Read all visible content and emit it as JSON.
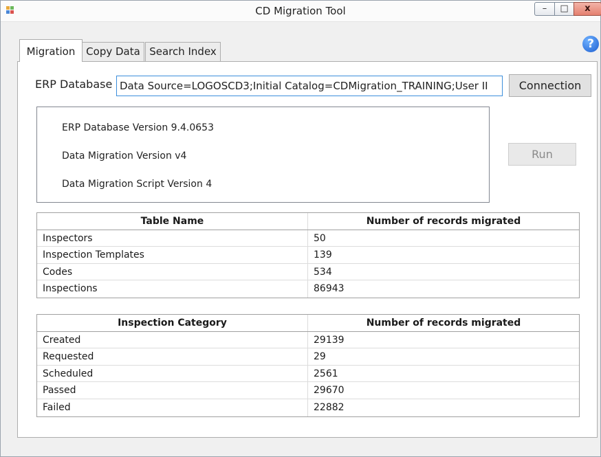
{
  "window": {
    "title": "CD Migration Tool",
    "minimize_glyph": "–",
    "maximize_glyph": "□",
    "close_glyph": "x",
    "help_glyph": "?"
  },
  "tabs": [
    {
      "label": "Migration",
      "active": true
    },
    {
      "label": "Copy Data",
      "active": false
    },
    {
      "label": "Search Index",
      "active": false
    }
  ],
  "erp": {
    "label": "ERP Database",
    "connection_string": "Data Source=LOGOSCD3;Initial Catalog=CDMigration_TRAINING;User II",
    "connection_button": "Connection"
  },
  "versions": [
    "ERP Database Version 9.4.0653",
    "Data Migration Version v4",
    "Data Migration Script Version 4"
  ],
  "run_button": "Run",
  "table_counts": {
    "headers": [
      "Table Name",
      "Number of records migrated"
    ],
    "rows": [
      [
        "Inspectors",
        "50"
      ],
      [
        "Inspection Templates",
        "139"
      ],
      [
        "Codes",
        "534"
      ],
      [
        "Inspections",
        "86943"
      ]
    ]
  },
  "category_counts": {
    "headers": [
      "Inspection Category",
      "Number of records migrated"
    ],
    "rows": [
      [
        "Created",
        "29139"
      ],
      [
        "Requested",
        "29"
      ],
      [
        "Scheduled",
        "2561"
      ],
      [
        "Passed",
        "29670"
      ],
      [
        "Failed",
        "22882"
      ]
    ]
  },
  "icons": {
    "app": "app-icon",
    "help": "help-icon"
  },
  "colors": {
    "input_focus_border": "#3b8edb",
    "help_icon": "#1d5fd0",
    "close_button": "#e4806f"
  }
}
